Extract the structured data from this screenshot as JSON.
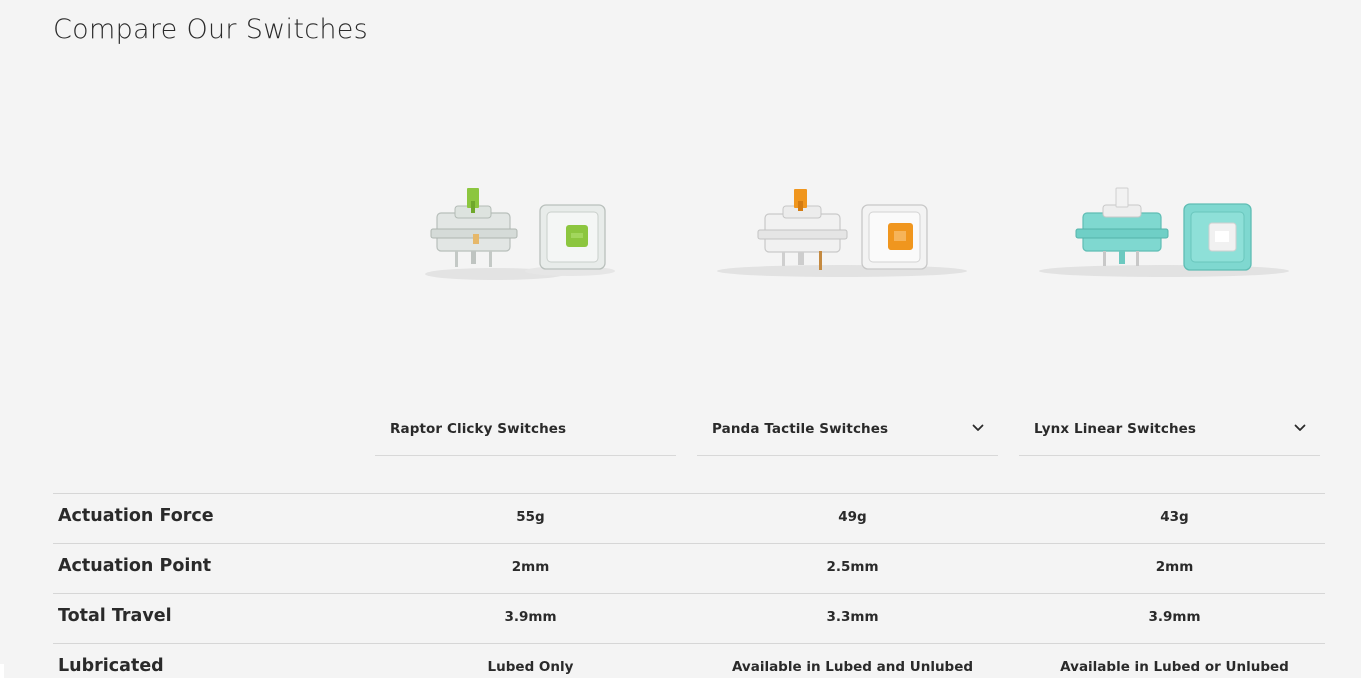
{
  "page": {
    "title": "Compare Our Switches"
  },
  "products": [
    {
      "name": "Raptor Clicky Switches",
      "has_dropdown": false,
      "stem_color": "#8cc63f",
      "housing_color": "#e4e8e6"
    },
    {
      "name": "Panda Tactile Switches",
      "has_dropdown": true,
      "stem_color": "#f0961e",
      "housing_color": "#f1f1f1"
    },
    {
      "name": "Lynx Linear Switches",
      "has_dropdown": true,
      "stem_color": "#f2f2f2",
      "housing_color": "#7fd8d0"
    }
  ],
  "specs": [
    {
      "label": "Actuation Force",
      "values": [
        "55g",
        "49g",
        "43g"
      ]
    },
    {
      "label": "Actuation Point",
      "values": [
        "2mm",
        "2.5mm",
        "2mm"
      ]
    },
    {
      "label": "Total Travel",
      "values": [
        "3.9mm",
        "3.3mm",
        "3.9mm"
      ]
    },
    {
      "label": "Lubricated",
      "values": [
        "Lubed Only",
        "Available in Lubed and Unlubed",
        "Available in Lubed or Unlubed"
      ]
    }
  ],
  "icons": {
    "dropdown": "chevron-down-icon"
  }
}
